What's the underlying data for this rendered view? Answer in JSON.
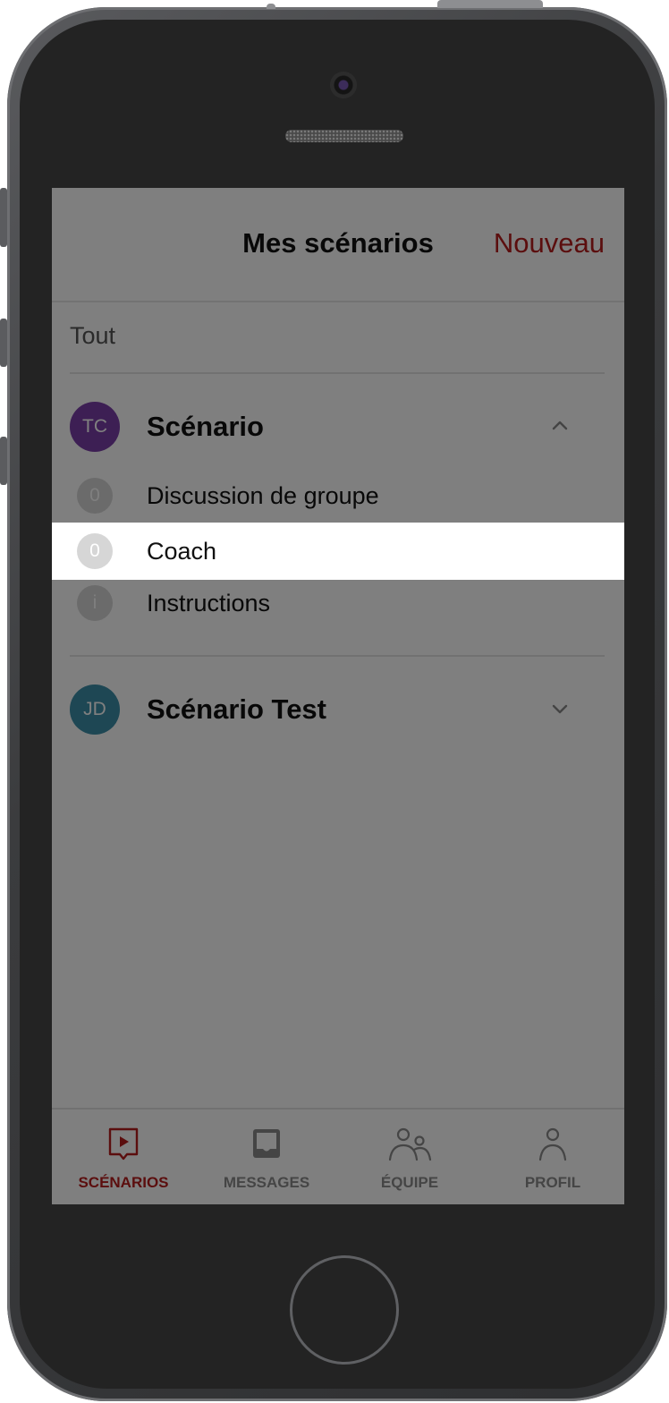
{
  "header": {
    "title": "Mes scénarios",
    "new_button": "Nouveau"
  },
  "filter": {
    "label": "Tout"
  },
  "groups": [
    {
      "initials": "TC",
      "avatar_color": "#7b3fa8",
      "name": "Scénario",
      "expanded": true,
      "items": [
        {
          "badge": "0",
          "label": "Discussion de groupe"
        },
        {
          "badge": "0",
          "label": "Coach",
          "highlighted": true
        },
        {
          "badge": "i",
          "label": "Instructions"
        }
      ]
    },
    {
      "initials": "JD",
      "avatar_color": "#3c8fa8",
      "name": "Scénario Test",
      "expanded": false
    }
  ],
  "tabbar": {
    "active_color": "#b71c1c",
    "tabs": [
      {
        "label": "SCÉNARIOS",
        "icon": "scenario-play-icon",
        "active": true
      },
      {
        "label": "MESSAGES",
        "icon": "inbox-icon"
      },
      {
        "label": "ÉQUIPE",
        "icon": "team-icon"
      },
      {
        "label": "PROFIL",
        "icon": "profile-icon"
      }
    ]
  }
}
